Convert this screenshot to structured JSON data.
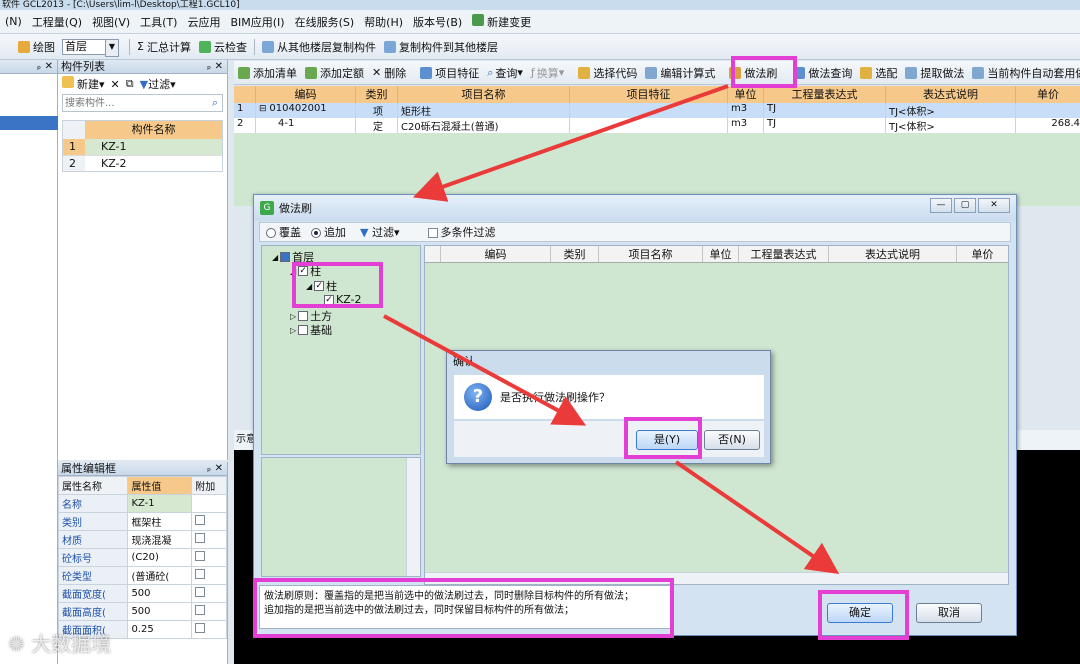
{
  "window": {
    "title": "软件 GCL2013 - [C:\\Users\\lim-l\\Desktop\\工程1.GCL10]"
  },
  "menu": [
    "(N)",
    "工程量(Q)",
    "视图(V)",
    "工具(T)",
    "云应用",
    "BIM应用(I)",
    "在线服务(S)",
    "帮助(H)",
    "版本号(B)",
    "新建变更"
  ],
  "toolbar": {
    "draw": "绘图",
    "floor": "首层",
    "sum_calc": "汇总计算",
    "cloud_check": "云检查",
    "copy_from": "从其他楼层复制构件",
    "copy_to": "复制构件到其他楼层"
  },
  "component_list": {
    "title": "构件列表",
    "new_label": "新建",
    "filter_label": "过滤",
    "search_placeholder": "搜索构件...",
    "column": "构件名称",
    "rows": [
      {
        "no": "1",
        "name": "KZ-1"
      },
      {
        "no": "2",
        "name": "KZ-2"
      }
    ]
  },
  "properties": {
    "title": "属性编辑框",
    "headers": [
      "属性名称",
      "属性值",
      "附加"
    ],
    "rows": [
      {
        "no": "1",
        "name": "名称",
        "value": "KZ-1"
      },
      {
        "no": "2",
        "name": "类别",
        "value": "框架柱"
      },
      {
        "no": "3",
        "name": "材质",
        "value": "现浇混凝"
      },
      {
        "no": "4",
        "name": "砼标号",
        "value": "(C20)"
      },
      {
        "no": "5",
        "name": "砼类型",
        "value": "(普通砼("
      },
      {
        "no": "6",
        "name": "截面宽度(",
        "value": "500"
      },
      {
        "no": "7",
        "name": "截面高度(",
        "value": "500"
      },
      {
        "no": "8",
        "name": "截面面积(",
        "value": "0.25"
      }
    ]
  },
  "main_toolbar": [
    "添加清单",
    "添加定额",
    "删除",
    "项目特征",
    "查询",
    "换算",
    "选择代码",
    "编辑计算式",
    "做法刷",
    "做法查询",
    "选配",
    "提取做法",
    "当前构件自动套用做法"
  ],
  "main_table": {
    "headers": [
      "编码",
      "类别",
      "项目名称",
      "项目特征",
      "单位",
      "工程量表达式",
      "表达式说明",
      "单价"
    ],
    "rows": [
      {
        "no": "1",
        "code": "010402001",
        "type": "项",
        "name": "矩形柱",
        "feature": "",
        "unit": "m3",
        "expr": "TJ",
        "desc": "TJ<体积>",
        "price": ""
      },
      {
        "no": "2",
        "code": "4-1",
        "type": "定",
        "name": "C20砾石混凝土(普通)",
        "feature": "",
        "unit": "m3",
        "expr": "TJ",
        "desc": "TJ<体积>",
        "price": "268.4"
      }
    ]
  },
  "dark_strip_label": "示意",
  "dialog": {
    "title": "做法刷",
    "overwrite": "覆盖",
    "append": "追加",
    "filter": "过滤",
    "multi_filter": "多条件过滤",
    "tree": {
      "root": "首层",
      "col1": "柱",
      "col2": "柱",
      "leaf": "KZ-2",
      "earth": "土方",
      "found": "基础"
    },
    "grid_headers": [
      "编码",
      "类别",
      "项目名称",
      "单位",
      "工程量表达式",
      "表达式说明",
      "单价"
    ],
    "note_line1": "做法刷原则：覆盖指的是把当前选中的做法刷过去，同时删除目标构件的所有做法；",
    "note_line2": "追加指的是把当前选中的做法刷过去，同时保留目标构件的所有做法；",
    "ok": "确定",
    "cancel": "取消"
  },
  "confirm": {
    "title": "确认",
    "message": "是否执行做法刷操作？",
    "yes": "是(Y)",
    "no": "否(N)"
  },
  "watermark": "大数据境"
}
